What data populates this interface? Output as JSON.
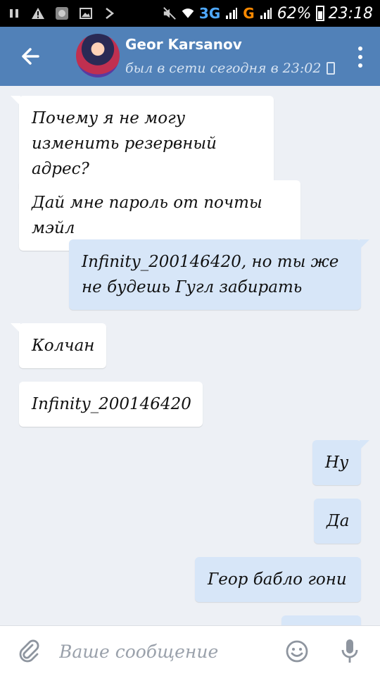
{
  "status_bar": {
    "network_1": "3G",
    "network_2": "G",
    "battery": "62%",
    "time": "23:18"
  },
  "header": {
    "contact_name": "Geor Karsanov",
    "last_seen": "был в сети сегодня в 23:02"
  },
  "messages": [
    {
      "direction": "in",
      "text": "Почему я не могу изменить резервный адрес?"
    },
    {
      "direction": "in",
      "text": "Дай мне пароль от почты мэйл"
    },
    {
      "direction": "out",
      "text": "Infinity_200146420, но ты же не будешь Гугл забирать"
    },
    {
      "direction": "in",
      "text": "Колчан"
    },
    {
      "direction": "in",
      "text": "Infinity_200146420"
    },
    {
      "direction": "out",
      "text": "Ну"
    },
    {
      "direction": "out",
      "text": "Да"
    },
    {
      "direction": "out",
      "text": "Геор бабло гони"
    }
  ],
  "composer": {
    "placeholder": "Ваше сообщение"
  },
  "colors": {
    "header": "#5181b8",
    "chat_background": "#edf0f5",
    "incoming_bubble": "#ffffff",
    "outgoing_bubble": "#d7e6f8"
  }
}
